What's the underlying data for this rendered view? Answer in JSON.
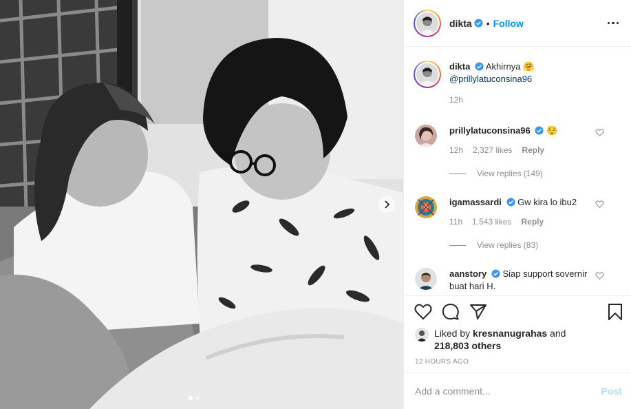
{
  "header": {
    "username": "dikta",
    "separator": "•",
    "follow_label": "Follow"
  },
  "caption": {
    "username": "dikta",
    "text": "Akhirnya",
    "emoji": "🤗",
    "mention": "@prillylatuconsina96",
    "time": "12h"
  },
  "comments": [
    {
      "username": "prillylatuconsina96",
      "verified": true,
      "text": "",
      "emoji": "😌",
      "time": "12h",
      "likes": "2,327 likes",
      "reply_label": "Reply",
      "view_replies": "View replies (149)"
    },
    {
      "username": "igamassardi",
      "verified": true,
      "text": "Gw kira lo ibu2",
      "emoji": "",
      "time": "11h",
      "likes": "1,543 likes",
      "reply_label": "Reply",
      "view_replies": "View replies (83)"
    },
    {
      "username": "aanstory",
      "verified": true,
      "text": "Siap support sovernir buat hari H.",
      "emoji": ""
    }
  ],
  "likes": {
    "prefix": "Liked by",
    "user": "kresnanugrahas",
    "and": "and",
    "count": "218,803 others"
  },
  "timestamp": "12 HOURS AGO",
  "add_comment": {
    "placeholder": "Add a comment...",
    "post_label": "Post"
  },
  "carousel": {
    "slide_count": 2,
    "active_index": 0
  },
  "icons": {
    "verified": "verified-badge-icon",
    "like": "heart-icon",
    "comment": "comment-icon",
    "share": "share-icon",
    "save": "bookmark-icon",
    "options": "more-icon",
    "next": "chevron-right-icon"
  },
  "colors": {
    "accent": "#0095f6",
    "muted": "#8e8e8e",
    "text": "#262626",
    "post_disabled": "#b2dffc",
    "mention": "#00376b"
  }
}
